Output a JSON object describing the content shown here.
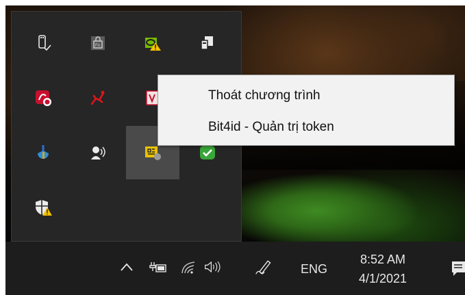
{
  "context_menu": {
    "items": [
      {
        "label": "Thoát chương trình"
      },
      {
        "label": "Bit4id - Quản trị token"
      }
    ]
  },
  "taskbar": {
    "language": "ENG",
    "time": "8:52 AM",
    "date": "4/1/2021"
  },
  "tray_icons": [
    "usb-drive-icon",
    "fn-lock-icon",
    "nvidia-warning-icon",
    "device-sync-icon",
    "red-app-icon",
    "red-runner-icon",
    "red-document-icon",
    "blue-drop-icon",
    "speaker-person-icon",
    "bit4id-token-icon",
    "green-check-shield-icon",
    "defender-warning-icon"
  ],
  "taskbar_icons": [
    "show-hidden-icons-chevron",
    "battery-power-icon",
    "wifi-icon",
    "volume-icon",
    "pen-workspace-icon",
    "action-center-icon"
  ],
  "colors": {
    "flyout_bg": "#262626",
    "taskbar_bg": "#1d1d1d",
    "menu_bg": "#f2f2f2",
    "accent_red": "#c8102e",
    "accent_green": "#3aa63a"
  }
}
